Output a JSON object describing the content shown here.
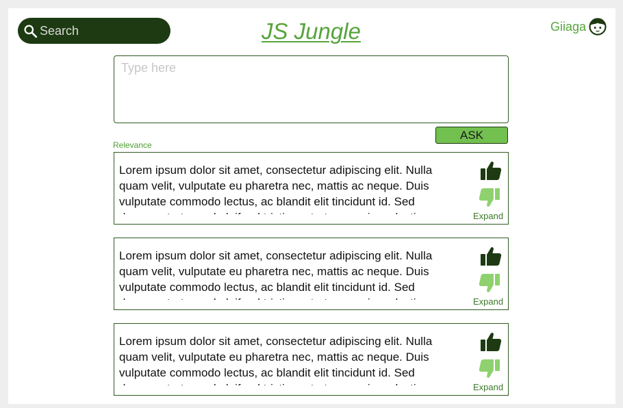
{
  "colors": {
    "dark_green": "#1d3a12",
    "accent_green": "#55a43a",
    "button_green": "#72c04f",
    "light_green": "#8fd16e"
  },
  "search": {
    "label": "Search",
    "icon": "search-icon"
  },
  "header": {
    "title": "JS Jungle"
  },
  "user": {
    "name": "Giiaga",
    "icon": "face-icon"
  },
  "question": {
    "placeholder": "Type here",
    "ask_label": "ASK"
  },
  "sort": {
    "label": "Relevance"
  },
  "answers": [
    {
      "text": "Lorem ipsum dolor sit amet, consectetur adipiscing elit. Nulla quam velit, vulputate eu pharetra nec, mattis ac neque. Duis vulputate commodo lectus, ac blandit elit tincidunt id. Sed rhoncus, tortor sed eleifend tristique, tortor mauris molestie",
      "expand_label": "Expand"
    },
    {
      "text": "Lorem ipsum dolor sit amet, consectetur adipiscing elit. Nulla quam velit, vulputate eu pharetra nec, mattis ac neque. Duis vulputate commodo lectus, ac blandit elit tincidunt id. Sed rhoncus, tortor sed eleifend tristique, tortor mauris molestie",
      "expand_label": "Expand"
    },
    {
      "text": "Lorem ipsum dolor sit amet, consectetur adipiscing elit. Nulla quam velit, vulputate eu pharetra nec, mattis ac neque. Duis vulputate commodo lectus, ac blandit elit tincidunt id. Sed rhoncus, tortor sed eleifend tristique, tortor mauris molestie",
      "expand_label": "Expand"
    }
  ]
}
